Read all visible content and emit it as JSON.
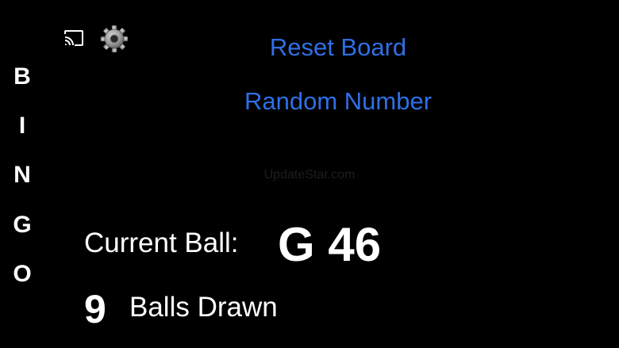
{
  "bingo": {
    "letters": [
      "B",
      "I",
      "N",
      "G",
      "O"
    ]
  },
  "icons": {
    "cast": "cast-icon",
    "settings": "gear-icon"
  },
  "actions": {
    "reset_label": "Reset Board",
    "random_label": "Random Number"
  },
  "watermark": "UpdateStar.com",
  "current_ball": {
    "label": "Current Ball:",
    "value": "G 46"
  },
  "balls_drawn": {
    "count": "9",
    "label": "Balls Drawn"
  },
  "colors": {
    "background": "#000000",
    "text": "#ffffff",
    "accent": "#2f6fe6"
  }
}
